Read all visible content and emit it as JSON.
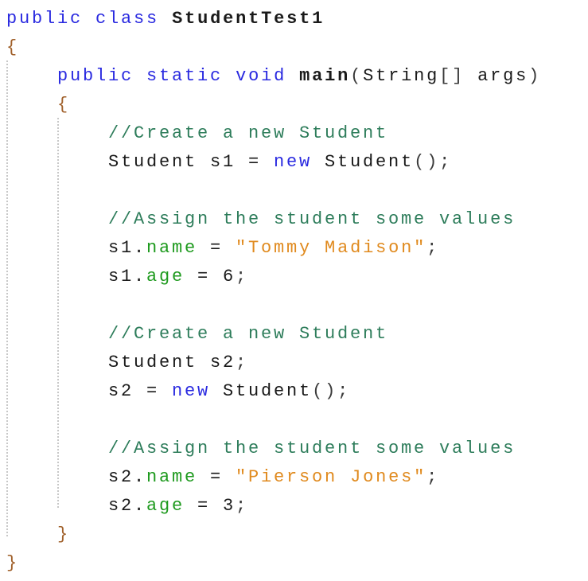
{
  "editor": {
    "language": "Java",
    "lines": [
      {
        "indent": 0,
        "tokens": [
          {
            "t": "public",
            "c": "kw"
          },
          {
            "t": " "
          },
          {
            "t": "class",
            "c": "kw"
          },
          {
            "t": " "
          },
          {
            "t": "StudentTest1",
            "c": "bold"
          }
        ]
      },
      {
        "indent": 0,
        "tokens": [
          {
            "t": "{",
            "c": "br"
          }
        ]
      },
      {
        "indent": 1,
        "tokens": [
          {
            "t": "public",
            "c": "kw"
          },
          {
            "t": " "
          },
          {
            "t": "static",
            "c": "kw"
          },
          {
            "t": " "
          },
          {
            "t": "void",
            "c": "kw"
          },
          {
            "t": " "
          },
          {
            "t": "main",
            "c": "bold"
          },
          {
            "t": "(",
            "c": "punc"
          },
          {
            "t": "String"
          },
          {
            "t": "[]",
            "c": "punc"
          },
          {
            "t": " args"
          },
          {
            "t": ")",
            "c": "punc"
          }
        ]
      },
      {
        "indent": 1,
        "tokens": [
          {
            "t": "{",
            "c": "br"
          }
        ]
      },
      {
        "indent": 2,
        "tokens": [
          {
            "t": "//Create a new Student",
            "c": "cm"
          }
        ]
      },
      {
        "indent": 2,
        "tokens": [
          {
            "t": "Student s1 = "
          },
          {
            "t": "new",
            "c": "kw"
          },
          {
            "t": " Student"
          },
          {
            "t": "();",
            "c": "punc"
          }
        ]
      },
      {
        "indent": 2,
        "tokens": []
      },
      {
        "indent": 2,
        "tokens": [
          {
            "t": "//Assign the student some values",
            "c": "cm"
          }
        ]
      },
      {
        "indent": 2,
        "tokens": [
          {
            "t": "s1."
          },
          {
            "t": "name",
            "c": "fld"
          },
          {
            "t": " = "
          },
          {
            "t": "\"Tommy Madison\"",
            "c": "str"
          },
          {
            "t": ";",
            "c": "punc"
          }
        ]
      },
      {
        "indent": 2,
        "tokens": [
          {
            "t": "s1."
          },
          {
            "t": "age",
            "c": "fld"
          },
          {
            "t": " = 6"
          },
          {
            "t": ";",
            "c": "punc"
          }
        ]
      },
      {
        "indent": 2,
        "tokens": []
      },
      {
        "indent": 2,
        "tokens": [
          {
            "t": "//Create a new Student",
            "c": "cm"
          }
        ]
      },
      {
        "indent": 2,
        "tokens": [
          {
            "t": "Student s2"
          },
          {
            "t": ";",
            "c": "punc"
          }
        ]
      },
      {
        "indent": 2,
        "tokens": [
          {
            "t": "s2 = "
          },
          {
            "t": "new",
            "c": "kw"
          },
          {
            "t": " Student"
          },
          {
            "t": "();",
            "c": "punc"
          }
        ]
      },
      {
        "indent": 2,
        "tokens": []
      },
      {
        "indent": 2,
        "tokens": [
          {
            "t": "//Assign the student some values",
            "c": "cm"
          }
        ]
      },
      {
        "indent": 2,
        "tokens": [
          {
            "t": "s2."
          },
          {
            "t": "name",
            "c": "fld"
          },
          {
            "t": " = "
          },
          {
            "t": "\"Pierson Jones\"",
            "c": "str"
          },
          {
            "t": ";",
            "c": "punc"
          }
        ]
      },
      {
        "indent": 2,
        "tokens": [
          {
            "t": "s2."
          },
          {
            "t": "age",
            "c": "fld"
          },
          {
            "t": " = 3"
          },
          {
            "t": ";",
            "c": "punc"
          }
        ]
      },
      {
        "indent": 1,
        "tokens": [
          {
            "t": "}",
            "c": "br"
          }
        ]
      },
      {
        "indent": 0,
        "tokens": [
          {
            "t": "}",
            "c": "br"
          }
        ]
      }
    ]
  }
}
